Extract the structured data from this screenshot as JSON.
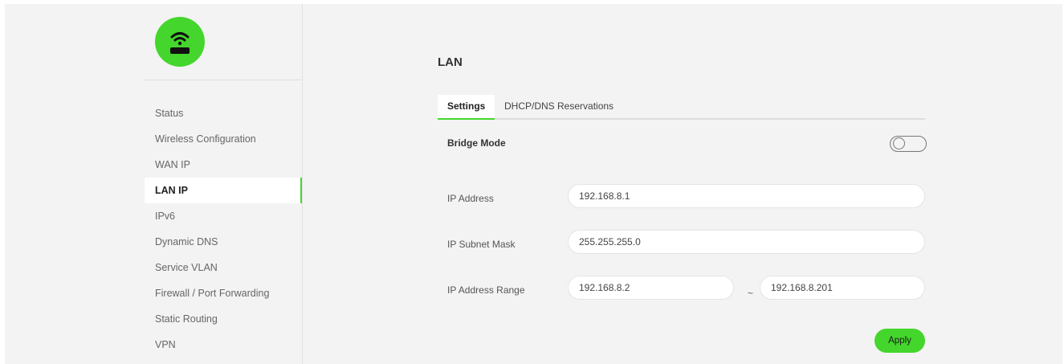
{
  "sidebar": {
    "logo_icon": "router-wifi-icon",
    "items": [
      {
        "label": "Status",
        "active": false
      },
      {
        "label": "Wireless Configuration",
        "active": false
      },
      {
        "label": "WAN IP",
        "active": false
      },
      {
        "label": "LAN IP",
        "active": true
      },
      {
        "label": "IPv6",
        "active": false
      },
      {
        "label": "Dynamic DNS",
        "active": false
      },
      {
        "label": "Service VLAN",
        "active": false
      },
      {
        "label": "Firewall / Port Forwarding",
        "active": false
      },
      {
        "label": "Static Routing",
        "active": false
      },
      {
        "label": "VPN",
        "active": false
      }
    ]
  },
  "main": {
    "title": "LAN",
    "tabs": [
      {
        "label": "Settings",
        "active": true
      },
      {
        "label": "DHCP/DNS Reservations",
        "active": false
      }
    ],
    "bridge_mode": {
      "label": "Bridge Mode",
      "enabled": false
    },
    "ip_address": {
      "label": "IP Address",
      "value": "192.168.8.1"
    },
    "subnet_mask": {
      "label": "IP Subnet Mask",
      "value": "255.255.255.0"
    },
    "ip_range": {
      "label": "IP Address Range",
      "start": "192.168.8.2",
      "separator": "~",
      "end": "192.168.8.201"
    },
    "apply_label": "Apply"
  },
  "colors": {
    "accent": "#44d62c",
    "background": "#f3f3f3"
  }
}
